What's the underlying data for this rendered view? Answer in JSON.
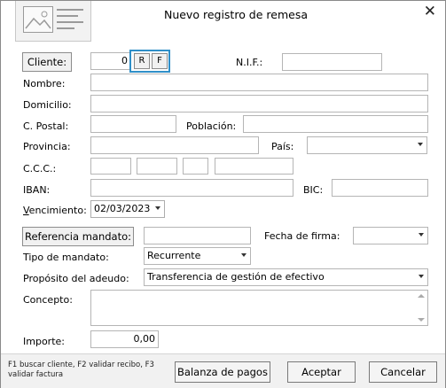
{
  "window": {
    "title": "Nuevo registro de remesa",
    "close_glyph": "✕"
  },
  "cliente": {
    "button_label": "Cliente:",
    "value": "0",
    "r_label": "R",
    "f_label": "F",
    "nif_label": "N.I.F.:",
    "nif_value": ""
  },
  "labels": {
    "nombre": "Nombre:",
    "domicilio": "Domicilio:",
    "cpostal": "C. Postal:",
    "poblacion": "Población:",
    "provincia": "Provincia:",
    "pais": "País:",
    "ccc": "C.C.C.:",
    "iban": "IBAN:",
    "bic": "BIC:",
    "vencimiento_first": "V",
    "vencimiento_rest": "encimiento:",
    "fecha_firma": "Fecha de firma:",
    "tipo_mandato": "Tipo de mandato:",
    "proposito": "Propósito del adeudo:",
    "concepto": "Concepto:",
    "importe": "Importe:"
  },
  "values": {
    "vencimiento": "02/03/2023",
    "tipo_mandato": "Recurrente",
    "proposito": "Transferencia de gestión de efectivo",
    "importe": "0,00"
  },
  "buttons": {
    "referencia_mandato": "Referencia mandato:",
    "balanza_pagos": "Balanza de pagos",
    "aceptar": "Aceptar",
    "cancelar": "Cancelar"
  },
  "footer": {
    "hint": "F1 buscar cliente, F2 validar recibo, F3 validar factura"
  }
}
